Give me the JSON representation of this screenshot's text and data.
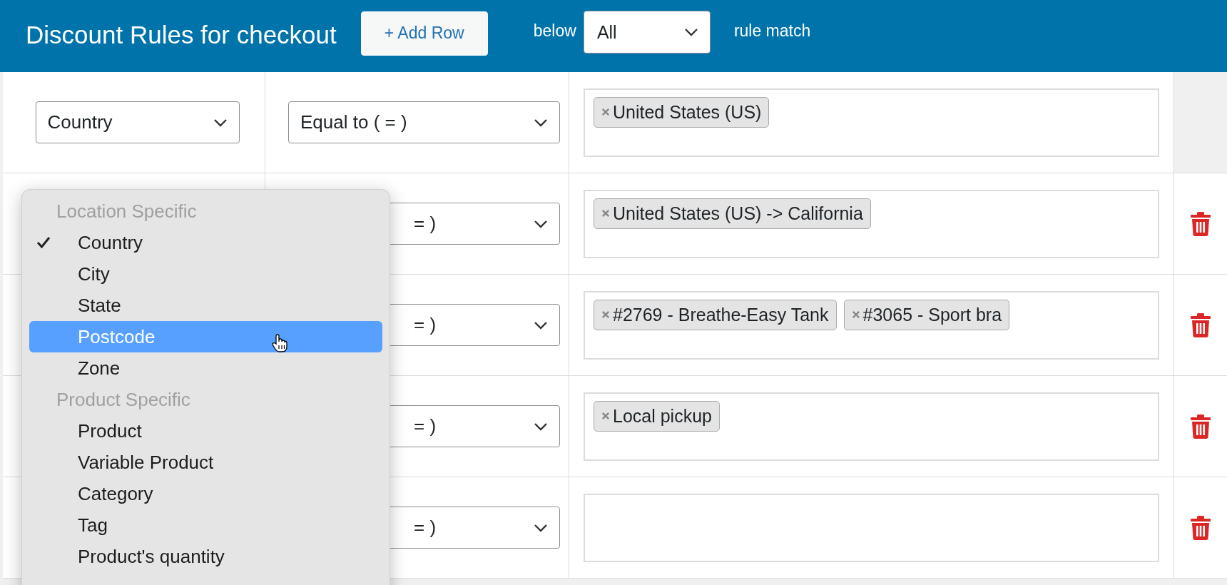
{
  "header": {
    "title": "Discount Rules for checkout",
    "add_button": "+ Add Row",
    "below_label": "below",
    "match_select": "All",
    "match_label": "rule match"
  },
  "rules": [
    {
      "condition": "Country",
      "operator": "Equal to ( = )",
      "values": [
        "United States (US)"
      ],
      "deletable": false
    },
    {
      "operator": "= )",
      "values": [
        "United States (US) -> California"
      ],
      "deletable": true
    },
    {
      "operator": "= )",
      "values": [
        "#2769 - Breathe-Easy Tank",
        "#3065 - Sport bra"
      ],
      "deletable": true
    },
    {
      "operator": "= )",
      "values": [
        "Local pickup"
      ],
      "deletable": true
    },
    {
      "operator": "= )",
      "deletable": true
    }
  ],
  "menu": {
    "items": [
      {
        "kind": "header",
        "label": "Location Specific"
      },
      {
        "kind": "option",
        "label": "Country",
        "checked": true,
        "highlighted": false
      },
      {
        "kind": "option",
        "label": "City",
        "checked": false,
        "highlighted": false
      },
      {
        "kind": "option",
        "label": "State",
        "checked": false,
        "highlighted": false
      },
      {
        "kind": "option",
        "label": "Postcode",
        "checked": false,
        "highlighted": true
      },
      {
        "kind": "option",
        "label": "Zone",
        "checked": false,
        "highlighted": false
      },
      {
        "kind": "header",
        "label": "Product Specific"
      },
      {
        "kind": "option",
        "label": "Product",
        "checked": false,
        "highlighted": false
      },
      {
        "kind": "option",
        "label": "Variable Product",
        "checked": false,
        "highlighted": false
      },
      {
        "kind": "option",
        "label": "Category",
        "checked": false,
        "highlighted": false
      },
      {
        "kind": "option",
        "label": "Tag",
        "checked": false,
        "highlighted": false
      },
      {
        "kind": "option",
        "label": "Product's quantity",
        "checked": false,
        "highlighted": false
      }
    ]
  }
}
